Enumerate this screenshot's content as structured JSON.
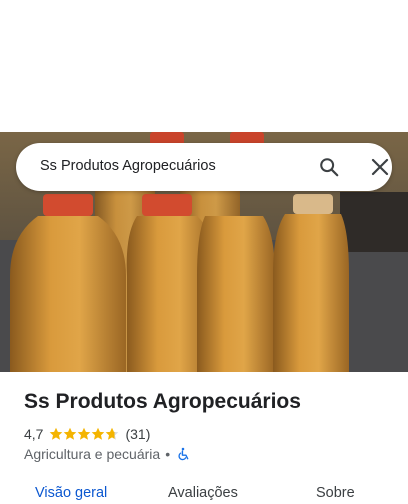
{
  "search": {
    "query": "Ss Produtos Agropecuários"
  },
  "place": {
    "name": "Ss Produtos Agropecuários",
    "rating": "4,7",
    "stars_value": 4.7,
    "stars_max": 5,
    "review_count": "(31)",
    "category": "Agricultura e pecuária",
    "separator": "•"
  },
  "tabs": [
    {
      "label": "Visão geral",
      "active": true
    },
    {
      "label": "Avaliações",
      "active": false
    },
    {
      "label": "Sobre",
      "active": false
    }
  ],
  "colors": {
    "accent": "#0b57d0",
    "star": "#f4b400",
    "text": "#202124",
    "secondary_text": "#5f6368"
  },
  "icons": {
    "search": "search-icon",
    "close": "close-icon",
    "accessibility": "wheelchair-icon",
    "star": "star-icon"
  }
}
